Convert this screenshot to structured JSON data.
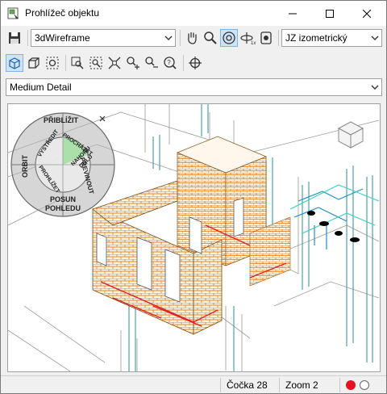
{
  "window": {
    "title": "Prohlížeč objektu",
    "controls": {
      "minimize": "minimize",
      "maximize": "maximize",
      "close": "close"
    }
  },
  "toolbar1": {
    "visual_style": "3dWireframe",
    "view": "JZ izometrický",
    "icons": [
      "save-icon",
      "pan-hand-icon",
      "zoom-icon",
      "orbit-icon",
      "camera-icon",
      "photo-icon"
    ]
  },
  "toolbar2": {
    "icons": [
      "view-cube-icon",
      "box-icon",
      "steering-wheel-icon",
      "zoom-window-icon",
      "zoom-extents-icon",
      "zoom-fit-icon",
      "zoom-in-icon",
      "zoom-out-icon",
      "zoom-help-icon",
      "crosshair-icon"
    ]
  },
  "detail": {
    "selected": "Medium Detail"
  },
  "steering_wheel": {
    "labels": {
      "zoom": "PŘIBLÍŽIT",
      "rewind": "PŘEVINOUT",
      "pan": "POSUN POHLEDU",
      "orbit": "ORBIT",
      "center": "VYSTŘEDIT",
      "walk": "PROCHÁZET",
      "look": "PROHLÍŽET",
      "updown": "NAHORU DOLŮ"
    }
  },
  "status": {
    "lens": "Čočka 28",
    "zoom": "Zoom 2"
  },
  "colors": {
    "accent": "#7eb4ea",
    "record": "#e81123",
    "brick": "#e58a1f"
  }
}
